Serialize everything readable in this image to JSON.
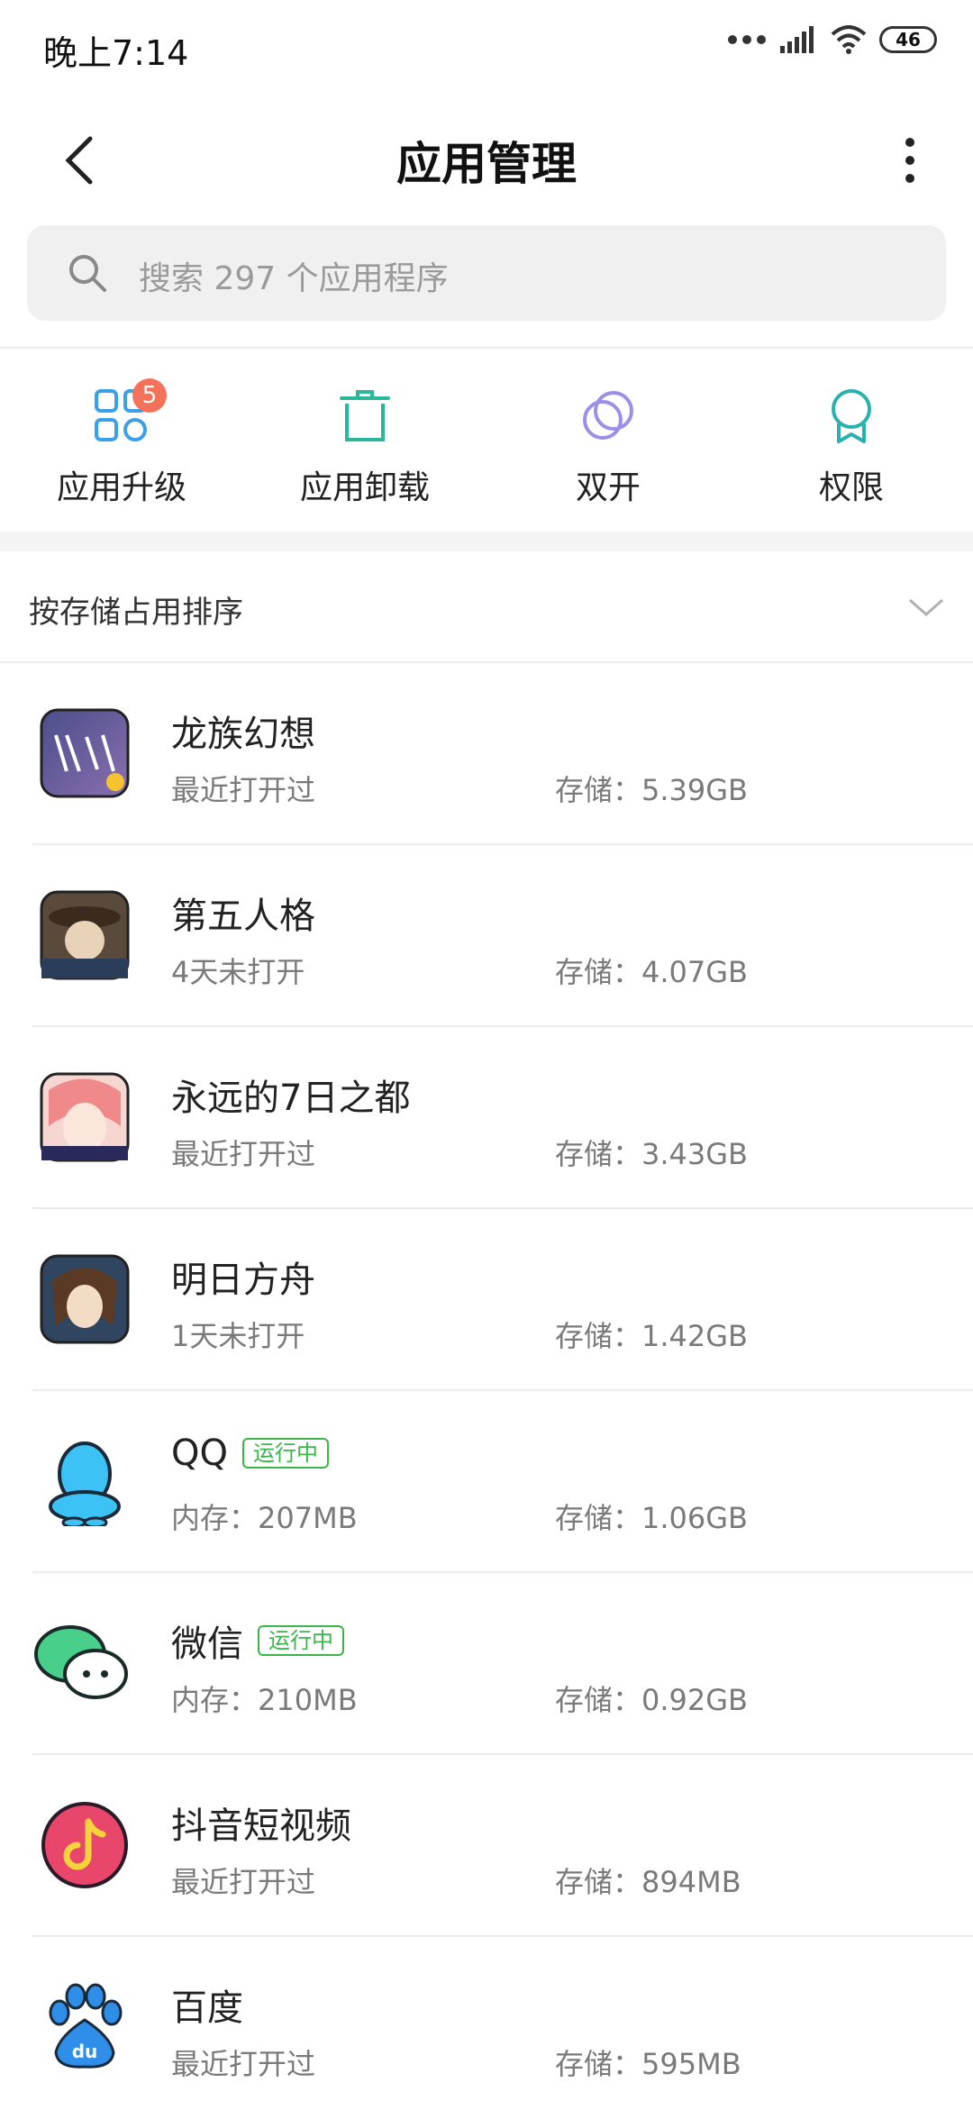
{
  "status": {
    "time": "晚上7:14",
    "battery": "46"
  },
  "nav": {
    "title": "应用管理"
  },
  "search": {
    "placeholder": "搜索 297 个应用程序"
  },
  "quick_actions": [
    {
      "label": "应用升级",
      "icon": "grid-apps-icon",
      "badge": "5",
      "color": "#3aa0e8"
    },
    {
      "label": "应用卸载",
      "icon": "trash-icon",
      "color": "#2bb89a"
    },
    {
      "label": "双开",
      "icon": "dual-circles-icon",
      "color": "#9b8fe8"
    },
    {
      "label": "权限",
      "icon": "ribbon-badge-icon",
      "color": "#2bb0b0"
    }
  ],
  "sort": {
    "label": "按存储占用排序"
  },
  "apps": [
    {
      "name": "龙族幻想",
      "sub": "最近打开过",
      "storage": "存储：5.39GB",
      "running": ""
    },
    {
      "name": "第五人格",
      "sub": "4天未打开",
      "storage": "存储：4.07GB",
      "running": ""
    },
    {
      "name": "永远的7日之都",
      "sub": "最近打开过",
      "storage": "存储：3.43GB",
      "running": ""
    },
    {
      "name": "明日方舟",
      "sub": "1天未打开",
      "storage": "存储：1.42GB",
      "running": ""
    },
    {
      "name": "QQ",
      "sub": "内存：207MB",
      "storage": "存储：1.06GB",
      "running": "运行中"
    },
    {
      "name": "微信",
      "sub": "内存：210MB",
      "storage": "存储：0.92GB",
      "running": "运行中"
    },
    {
      "name": "抖音短视频",
      "sub": "最近打开过",
      "storage": "存储：894MB",
      "running": ""
    },
    {
      "name": "百度",
      "sub": "最近打开过",
      "storage": "存储：595MB",
      "running": ""
    }
  ],
  "colors": {
    "accent_green": "#3ab54a",
    "badge_red": "#f4715a"
  }
}
